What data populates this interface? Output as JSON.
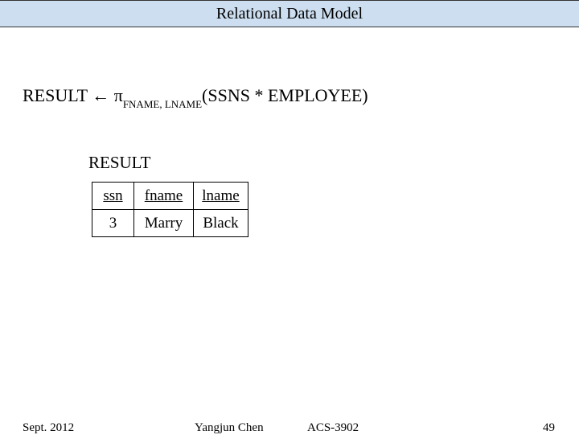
{
  "header": {
    "title": "Relational Data Model"
  },
  "formula": {
    "lhs": "RESULT ",
    "arrow": "← ",
    "pi": "π",
    "sub": "FNAME, LNAME",
    "paren_open": "(SSNS ",
    "join": "*",
    "paren_close": " EMPLOYEE)"
  },
  "result": {
    "label": "RESULT",
    "headers": {
      "c1": "ssn",
      "c2": "fname",
      "c3": "lname"
    },
    "row": {
      "c1": "3",
      "c2": "Marry",
      "c3": "Black"
    }
  },
  "footer": {
    "date": "Sept. 2012",
    "author": "Yangjun Chen",
    "course": "ACS-3902",
    "page": "49"
  }
}
